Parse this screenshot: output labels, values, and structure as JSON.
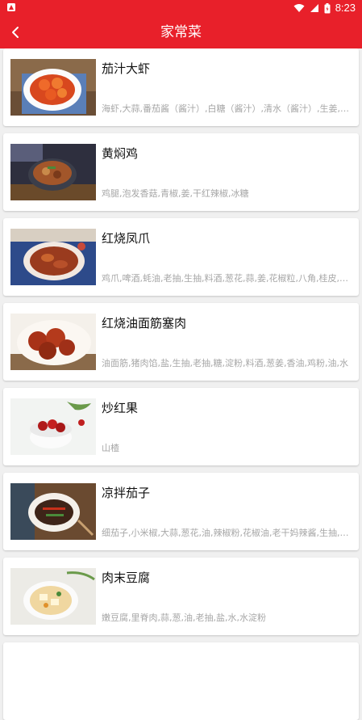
{
  "status": {
    "time": "8:23"
  },
  "header": {
    "title": "家常菜"
  },
  "recipes": [
    {
      "name": "茄汁大虾",
      "ingredients": "海虾,大蒜,番茄酱（酱汁）,白糖（酱汁）,清水（酱汁）,生姜,料酒"
    },
    {
      "name": "黄焖鸡",
      "ingredients": "鸡腿,泡发香菇,青椒,姜,干红辣椒,冰糖"
    },
    {
      "name": "红烧凤爪",
      "ingredients": "鸡爪,啤酒,蚝油,老抽,生抽,料酒,葱花,蒜,姜,花椒粒,八角,桂皮,香叶"
    },
    {
      "name": "红烧油面筋塞肉",
      "ingredients": "油面筋,猪肉馅,盐,生抽,老抽,糖,淀粉,料酒,葱姜,香油,鸡粉,油,水"
    },
    {
      "name": "炒红果",
      "ingredients": "山楂"
    },
    {
      "name": "凉拌茄子",
      "ingredients": "细茄子,小米椒,大蒜,葱花,油,辣椒粉,花椒油,老干妈辣酱,生抽,香醋"
    },
    {
      "name": "肉末豆腐",
      "ingredients": "嫩豆腐,里脊肉,蒜,葱,油,老抽,盐,水,水淀粉"
    }
  ]
}
